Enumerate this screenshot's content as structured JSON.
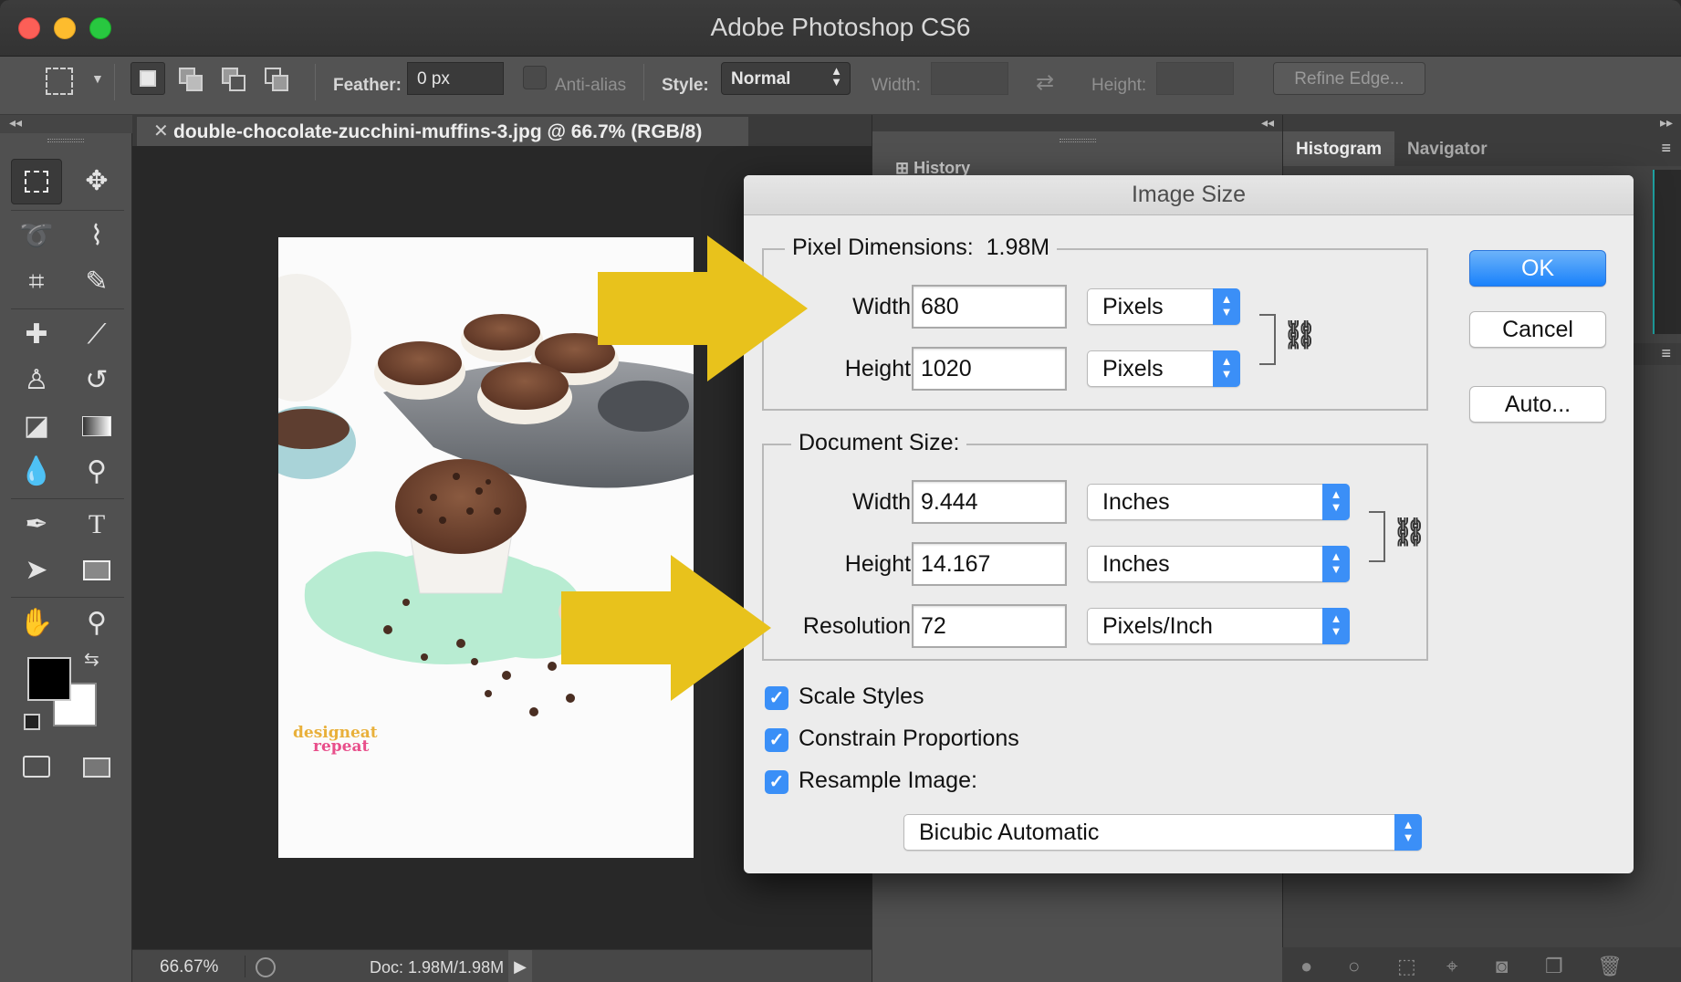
{
  "window": {
    "title": "Adobe Photoshop CS6"
  },
  "options_bar": {
    "feather_label": "Feather:",
    "feather_value": "0 px",
    "antialias_label": "Anti-alias",
    "style_label": "Style:",
    "style_value": "Normal",
    "width_label": "Width:",
    "height_label": "Height:",
    "refine_edge_label": "Refine Edge..."
  },
  "document": {
    "tab_title": "double-chocolate-zucchini-muffins-3.jpg @ 66.7% (RGB/8)",
    "zoom": "66.67%",
    "doc_info": "Doc: 1.98M/1.98M",
    "watermark_line1": "designeat",
    "watermark_line2": "repeat"
  },
  "panels": {
    "history_label": "History",
    "tabs": [
      "Histogram",
      "Navigator"
    ]
  },
  "dialog": {
    "title": "Image Size",
    "pixel_dimensions_label": "Pixel Dimensions:",
    "pixel_dimensions_value": "1.98M",
    "pd_width_label": "Width:",
    "pd_width_value": "680",
    "pd_width_unit": "Pixels",
    "pd_height_label": "Height:",
    "pd_height_value": "1020",
    "pd_height_unit": "Pixels",
    "document_size_label": "Document Size:",
    "ds_width_label": "Width:",
    "ds_width_value": "9.444",
    "ds_width_unit": "Inches",
    "ds_height_label": "Height:",
    "ds_height_value": "14.167",
    "ds_height_unit": "Inches",
    "resolution_label": "Resolution:",
    "resolution_value": "72",
    "resolution_unit": "Pixels/Inch",
    "scale_styles_label": "Scale Styles",
    "constrain_label": "Constrain Proportions",
    "resample_label": "Resample Image:",
    "resample_method": "Bicubic Automatic",
    "ok_label": "OK",
    "cancel_label": "Cancel",
    "auto_label": "Auto...",
    "checkboxes": {
      "scale_styles": true,
      "constrain_proportions": true,
      "resample_image": true
    }
  },
  "colors": {
    "accent_blue": "#3b8ff7",
    "annotation_arrow": "#e8c21c",
    "foreground_swatch": "#000000",
    "background_swatch": "#ffffff"
  }
}
